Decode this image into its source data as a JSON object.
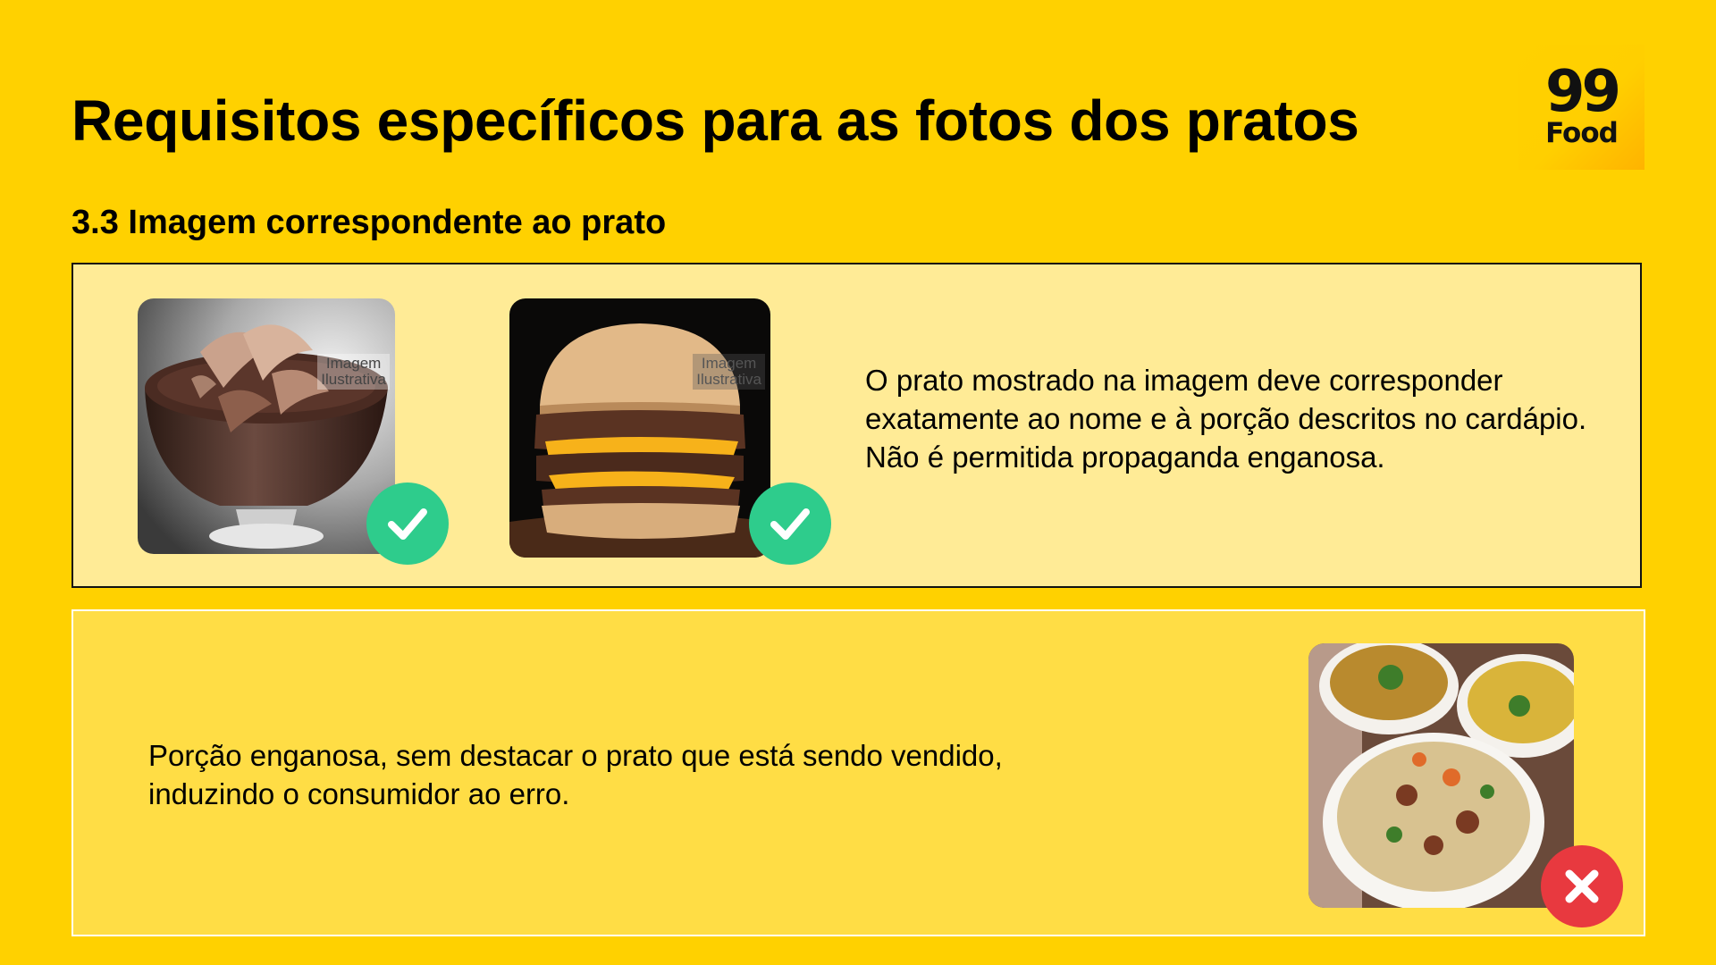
{
  "page": {
    "title": "Requisitos específicos para as fotos dos pratos",
    "subtitle": "3.3 Imagem correspondente ao prato"
  },
  "logo": {
    "number": "99",
    "word": "Food"
  },
  "colors": {
    "background": "#FFD100",
    "good_panel": "#FFEB96",
    "bad_panel": "#FFDD45",
    "check_green": "#2ECC8C",
    "cross_red": "#E8393F"
  },
  "good_example": {
    "images": [
      {
        "subject": "chocolate-mousse-photo",
        "watermark": [
          "Imagem",
          "Ilustrativa"
        ],
        "status": "check-icon"
      },
      {
        "subject": "burger-photo",
        "watermark": [
          "Imagem",
          "Ilustrativa"
        ],
        "status": "check-icon"
      }
    ],
    "description": "O prato mostrado na imagem deve corresponder exatamente ao nome e à porção descritos no cardápio. Não é permitida propaganda enganosa."
  },
  "bad_example": {
    "description": "Porção enganosa, sem destacar o prato que está sendo vendido, induzindo o consumidor ao erro.",
    "image": {
      "subject": "rice-and-soups-photo",
      "status": "cross-icon"
    }
  }
}
